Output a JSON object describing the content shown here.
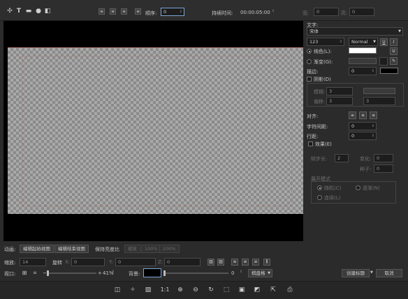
{
  "toolbar": {
    "order_label": "顺序:",
    "order_value": "0",
    "duration_label": "持续时间:",
    "duration_value": "00:00:05:00",
    "width_label": "宽:",
    "width_value": "0",
    "height_label": "高:",
    "height_value": "0"
  },
  "panel": {
    "text_label": "文字:",
    "font_name": "宋体",
    "font_size": "123",
    "font_style": "Normal",
    "underline_label": "U",
    "italic_label": "I",
    "solid_color_label": "纯色(L):",
    "solid_color": "#ffffff",
    "gradient_label": "渐变(G):",
    "gradient_value": "渐变",
    "stroke_label": "描边:",
    "stroke_value": "0",
    "stroke_color": "#000000",
    "shadow_label": "阴影(D)",
    "blur_label": "模糊:",
    "blur_value": "3",
    "offset_label": "偏移:",
    "offset_value_1": "3",
    "offset_value_2": "3",
    "align_label": "对齐:",
    "spacing_label": "字符间距:",
    "spacing_value": "0",
    "line_label": "行距:",
    "line_value": "0",
    "effect_label": "效果(E)",
    "step_label": "帧步长:",
    "step_value": "2",
    "change_label": "变化:",
    "change_value": "0",
    "seed_label": "种子:",
    "seed_value": "0",
    "reveal_title": "展开模式",
    "opt_random": "随机(C)",
    "opt_gradual": "逐渐(N)",
    "opt_consecutive": "连续(L)"
  },
  "animation": {
    "label": "动画:",
    "edit_start": "编辑起始视图",
    "edit_end": "编辑结束视图",
    "keep_ratio": "保持亮度比",
    "zoom1": "缩放",
    "zoom2": "100%",
    "zoom3": "200%"
  },
  "transform": {
    "scale_label": "缩放:",
    "scale_value": "14",
    "rotate_label": "旋转",
    "x_label": "X:",
    "x_value": "0",
    "y_label": "Y:",
    "y_value": "0",
    "z_label": "Z:",
    "z_value": "0"
  },
  "viewport": {
    "label": "视口:",
    "zoom_value": "41%",
    "bg_label": "背景:",
    "bg_color": "#000000",
    "opacity_value": "0",
    "mode_value": "棋盘格",
    "create_title": "创建标题",
    "cancel": "取消"
  },
  "colors": {
    "accent": "#7aa7d8"
  }
}
